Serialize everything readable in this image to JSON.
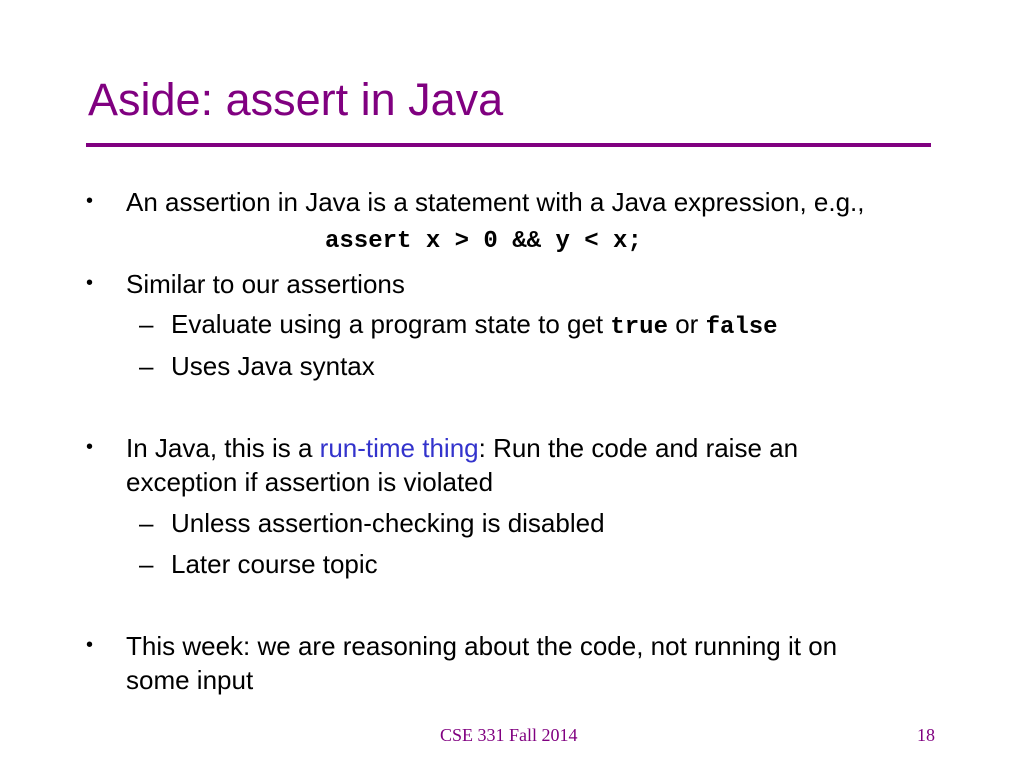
{
  "slide": {
    "title": "Aside: assert in Java",
    "colors": {
      "title": "#800080",
      "rule": "#800080",
      "accent": "#3333cc",
      "footer": "#800080"
    },
    "bullets": [
      {
        "text": "An assertion in Java is a statement with a Java expression, e.g.,",
        "code": "assert x > 0 && y < x;"
      },
      {
        "text": "Similar to our assertions",
        "sub": [
          {
            "before": "Evaluate using a program state to get ",
            "code1": "true",
            "middle": " or ",
            "code2": "false"
          },
          {
            "text": "Uses Java syntax"
          }
        ]
      },
      {
        "before": "In Java, this is a ",
        "highlight": "run-time thing",
        "after": ": Run the code and raise an",
        "continuation": "exception if assertion is violated",
        "sub": [
          {
            "text": "Unless assertion-checking is disabled"
          },
          {
            "text": "Later course topic"
          }
        ]
      },
      {
        "text": "This week: we are reasoning about the code, not running it on",
        "continuation": "some input"
      }
    ],
    "bullet_glyph": "•",
    "dash_glyph": "–",
    "footer": {
      "course": "CSE 331 Fall 2014",
      "page": "18"
    }
  }
}
